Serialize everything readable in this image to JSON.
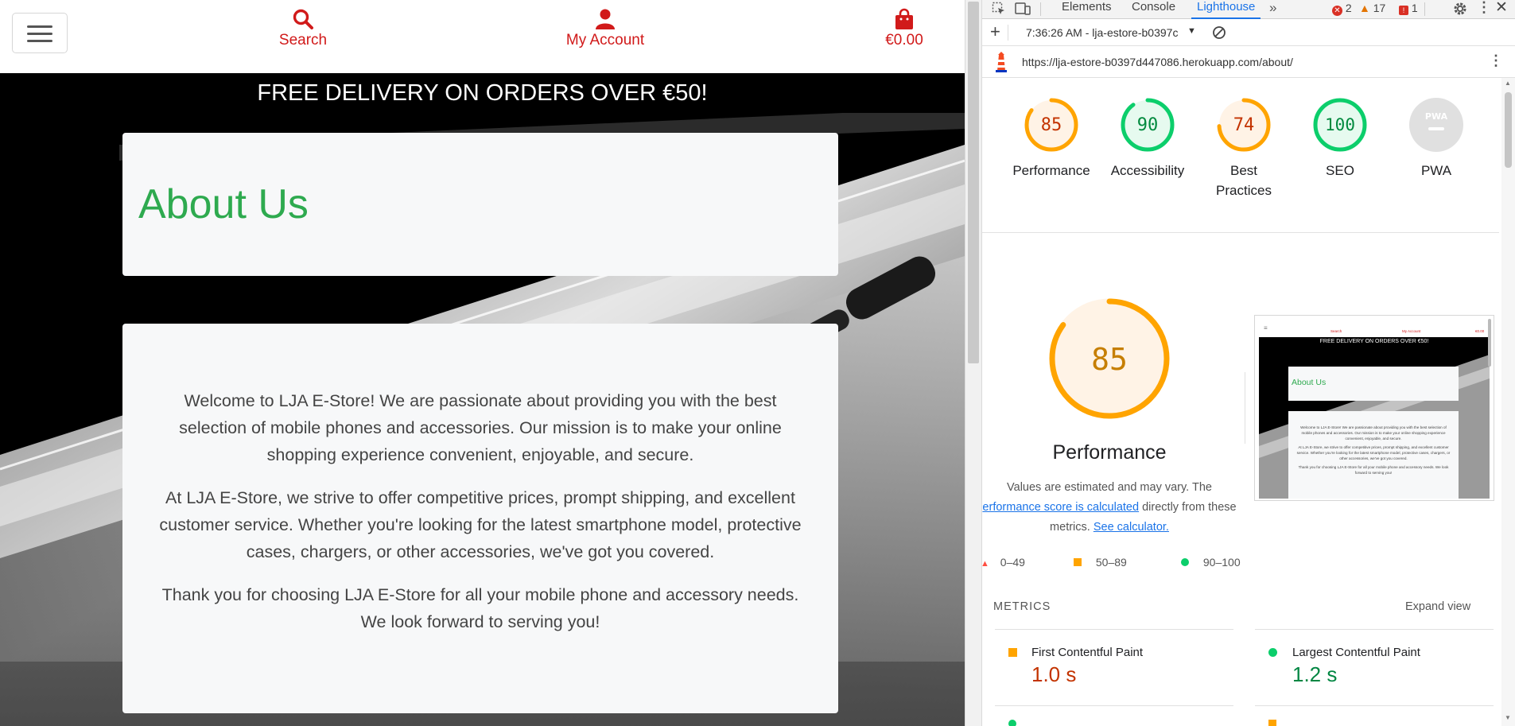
{
  "site": {
    "nav": {
      "search_label": "Search",
      "account_label": "My Account",
      "cart_total": "€0.00"
    },
    "banner": "FREE DELIVERY ON ORDERS OVER €50!",
    "title": "About Us",
    "paragraphs": [
      "Welcome to LJA E-Store! We are passionate about providing you with the best selection of mobile phones and accessories. Our mission is to make your online shopping experience convenient, enjoyable, and secure.",
      "At LJA E-Store, we strive to offer competitive prices, prompt shipping, and excellent customer service. Whether you're looking for the latest smartphone model, protective cases, chargers, or other accessories, we've got you covered.",
      "Thank you for choosing LJA E-Store for all your mobile phone and accessory needs. We look forward to serving you!"
    ],
    "colors": {
      "accent_red": "#d11a1a",
      "title_green": "#2eaa4f"
    }
  },
  "devtools": {
    "tabs": [
      "Elements",
      "Console",
      "Lighthouse"
    ],
    "active_tab": "Lighthouse",
    "counts": {
      "errors": "2",
      "warnings": "17",
      "issues": "1"
    },
    "report_select": "7:36:26 AM - lja-estore-b0397c",
    "url": "https://lja-estore-b0397d447086.herokuapp.com/about/",
    "scores": [
      {
        "label": "Performance",
        "value": 85,
        "display": "85",
        "color": "#ffa400"
      },
      {
        "label": "Accessibility",
        "value": 90,
        "display": "90",
        "color": "#0cce6b"
      },
      {
        "label": "Best Practices",
        "value": 74,
        "display": "74",
        "color": "#ffa400"
      },
      {
        "label": "SEO",
        "value": 100,
        "display": "100",
        "color": "#0cce6b"
      },
      {
        "label": "PWA",
        "value": 0,
        "display": "PWA",
        "color": "#bdbdbd"
      }
    ],
    "perf": {
      "score": 85,
      "score_display": "85",
      "title": "Performance",
      "note_text_1": "Values are estimated and may vary. The",
      "note_link_1": "erformance score is calculated",
      "note_text_2": "directly from these metrics.",
      "note_link_2": "See calculator.",
      "legend": [
        "0–49",
        "50–89",
        "90–100"
      ]
    },
    "thumbnail": {
      "nav": [
        "Search",
        "My Account",
        "€0.00"
      ],
      "banner": "FREE DELIVERY ON ORDERS OVER €50!",
      "title": "About Us",
      "lines": [
        "Welcome to LJA E-Store! We are passionate about providing you with the best selection of mobile phones and accessories. Our mission is to make your online shopping experience convenient, enjoyable, and secure.",
        "At LJA E-Store, we strive to offer competitive prices, prompt shipping, and excellent customer service. Whether you're looking for the latest smartphone model, protective cases, chargers, or other accessories, we've got you covered.",
        "Thank you for choosing LJA E-Store for all your mobile phone and accessory needs. We look forward to serving you!"
      ]
    },
    "metrics": {
      "heading": "METRICS",
      "expand": "Expand view",
      "items": [
        {
          "name": "First Contentful Paint",
          "value": "1.0 s",
          "color": "#c33300"
        },
        {
          "name": "Largest Contentful Paint",
          "value": "1.2 s",
          "color": "#018642"
        }
      ]
    }
  }
}
